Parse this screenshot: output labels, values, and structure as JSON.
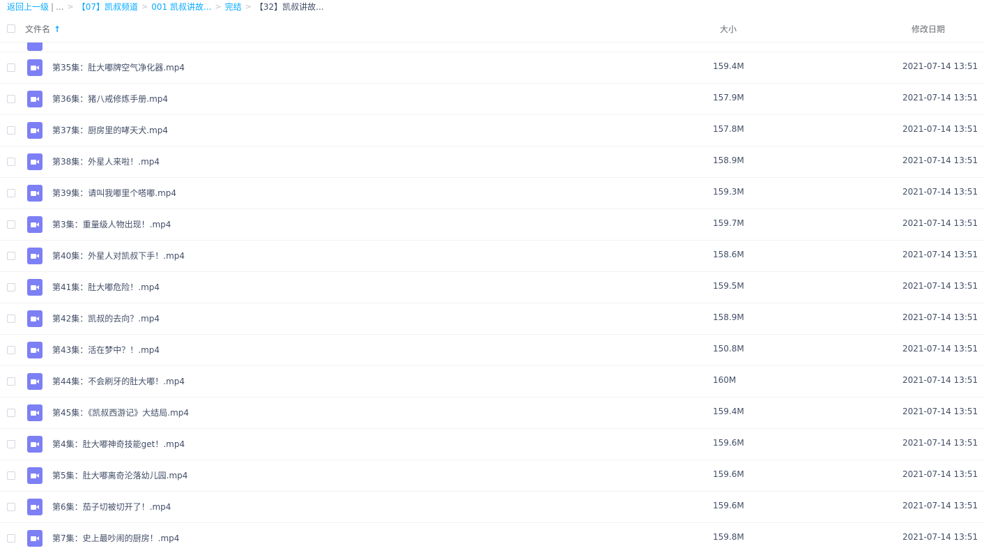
{
  "breadcrumb": {
    "back": "返回上一级",
    "divider": "|",
    "ellipsis": "...",
    "sep": ">",
    "items": [
      "【07】凯叔频道",
      "001 凯叔讲故...",
      "完结"
    ],
    "current": "【32】凯叔讲故..."
  },
  "header": {
    "name": "文件名",
    "size": "大小",
    "date": "修改日期",
    "sort_icon": "↑"
  },
  "files": [
    {
      "name": "第35集：肚大嘟牌空气净化器.mp4",
      "size": "159.4M",
      "date": "2021-07-14 13:51"
    },
    {
      "name": "第36集：猪八戒修炼手册.mp4",
      "size": "157.9M",
      "date": "2021-07-14 13:51"
    },
    {
      "name": "第37集：厨房里的哮天犬.mp4",
      "size": "157.8M",
      "date": "2021-07-14 13:51"
    },
    {
      "name": "第38集：外星人来啦！.mp4",
      "size": "158.9M",
      "date": "2021-07-14 13:51"
    },
    {
      "name": "第39集：请叫我嘟里个嗒嘟.mp4",
      "size": "159.3M",
      "date": "2021-07-14 13:51"
    },
    {
      "name": "第3集：重量级人物出现！.mp4",
      "size": "159.7M",
      "date": "2021-07-14 13:51"
    },
    {
      "name": "第40集：外星人对凯叔下手！.mp4",
      "size": "158.6M",
      "date": "2021-07-14 13:51"
    },
    {
      "name": "第41集：肚大嘟危险！.mp4",
      "size": "159.5M",
      "date": "2021-07-14 13:51"
    },
    {
      "name": "第42集：凯叔的去向？.mp4",
      "size": "158.9M",
      "date": "2021-07-14 13:51"
    },
    {
      "name": "第43集：活在梦中？！.mp4",
      "size": "150.8M",
      "date": "2021-07-14 13:51"
    },
    {
      "name": "第44集：不会刷牙的肚大嘟！.mp4",
      "size": "160M",
      "date": "2021-07-14 13:51"
    },
    {
      "name": "第45集：《凯叔西游记》大结局.mp4",
      "size": "159.4M",
      "date": "2021-07-14 13:51"
    },
    {
      "name": "第4集：肚大嘟神奇技能get！.mp4",
      "size": "159.6M",
      "date": "2021-07-14 13:51"
    },
    {
      "name": "第5集：肚大嘟离奇沦落幼儿园.mp4",
      "size": "159.6M",
      "date": "2021-07-14 13:51"
    },
    {
      "name": "第6集：茄子切被切开了！.mp4",
      "size": "159.6M",
      "date": "2021-07-14 13:51"
    },
    {
      "name": "第7集：史上最吵闹的厨房！.mp4",
      "size": "159.8M",
      "date": "2021-07-14 13:51"
    }
  ],
  "colors": {
    "link": "#09aaff",
    "video_icon": "#7d7ff5",
    "text": "#424e67"
  },
  "icons": {
    "file": "video-file-icon",
    "sort": "sort-ascending-icon"
  }
}
